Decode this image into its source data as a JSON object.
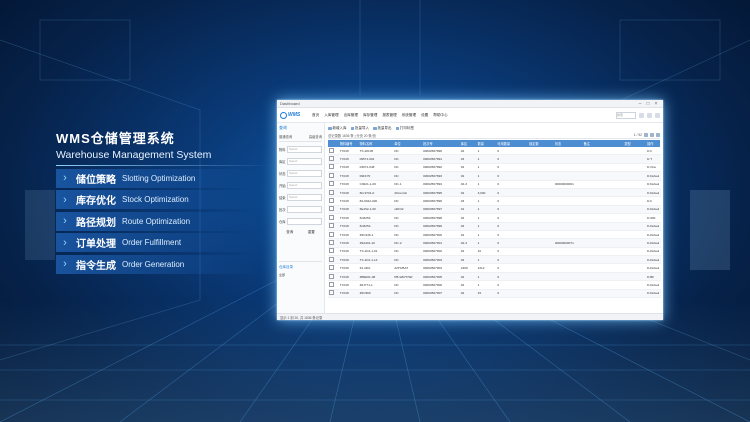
{
  "promo": {
    "title": "WMS仓储管理系统",
    "subtitle": "Warehouse Management System",
    "features": [
      {
        "cn": "储位策略",
        "en": "Slotting Optimization"
      },
      {
        "cn": "库存优化",
        "en": "Stock Optimization"
      },
      {
        "cn": "路径规划",
        "en": "Route Optimization"
      },
      {
        "cn": "订单处理",
        "en": "Order Fulfillment"
      },
      {
        "cn": "指令生成",
        "en": "Order Generation"
      }
    ]
  },
  "app": {
    "window_title": "Dashboard",
    "logo_text": "WMS",
    "menu": [
      "首页",
      "入库管理",
      "出库管理",
      "库存管理",
      "报表管理",
      "系统管理",
      "设置",
      "帮助中心"
    ],
    "header_search_placeholder": "搜索",
    "sidebar": {
      "title": "查询",
      "tabs": [
        "普通查询",
        "高级查询"
      ],
      "filters": [
        {
          "label": "物料",
          "placeholder": "Select"
        },
        {
          "label": "库区",
          "placeholder": "Select"
        },
        {
          "label": "状态",
          "placeholder": "Select"
        },
        {
          "label": "开始",
          "placeholder": "Select"
        },
        {
          "label": "结束",
          "placeholder": "Select"
        },
        {
          "label": "批次",
          "placeholder": ""
        },
        {
          "label": "仓库",
          "placeholder": ""
        }
      ],
      "buttons": [
        "查询",
        "重置"
      ],
      "tree_title": "仓库目录",
      "tree_items": [
        "全部"
      ]
    },
    "toolbar": [
      "新增入库",
      "批量导入",
      "批量导出",
      "打印标签"
    ],
    "sub_toolbar": {
      "left": "总记录数 1836 条 | 分页 20 条/页",
      "right": "1 / 92"
    },
    "table": {
      "headers": [
        "",
        "物料编号",
        "物料名称",
        "单位",
        "批次号",
        "库区",
        "数量",
        "可用数量",
        "锁定数",
        "状态",
        "备注",
        "类型",
        "操作"
      ],
      "rows": [
        [
          "TXCW",
          "TX-20105",
          "DC",
          "00002567890",
          "02",
          "1",
          "0",
          "",
          "",
          "",
          "",
          "D.b",
          ""
        ],
        [
          "TXCW",
          "09571-001",
          "DC",
          "00002567891",
          "03",
          "1",
          "0",
          "",
          "",
          "",
          "",
          "D.T",
          ""
        ],
        [
          "TXCW",
          "03071-048",
          "DC",
          "00002567892",
          "02",
          "1",
          "0",
          "",
          "",
          "",
          "",
          "D.One",
          ""
        ],
        [
          "TXCW",
          "09FF70",
          "DC",
          "00002567893",
          "02",
          "1",
          "0",
          "",
          "",
          "",
          "",
          "D.Defaul",
          ""
        ],
        [
          "TXCW",
          "C3021-1-06",
          "DC-1",
          "00002567894",
          "02-3",
          "1",
          "0",
          "",
          "00000000001",
          "",
          "",
          "D.Defaul",
          ""
        ],
        [
          "TXCW",
          "6D-9701-0",
          "20mm/dc",
          "00002567895",
          "02",
          "3,000",
          "0",
          "",
          "",
          "",
          "",
          "D.Defaul",
          ""
        ],
        [
          "TXCW",
          "84-0322-020",
          "DC",
          "00002567896",
          "03",
          "1",
          "0",
          "",
          "",
          "",
          "",
          "D.b",
          ""
        ],
        [
          "TXCW",
          "6E152-1-00",
          "sDF32",
          "00002567897",
          "01",
          "1",
          "0",
          "",
          "",
          "",
          "",
          "D.Defaul",
          ""
        ],
        [
          "TXCW",
          "6C8254",
          "DC",
          "00002567898",
          "02",
          "1",
          "0",
          "",
          "",
          "",
          "",
          "D.000",
          ""
        ],
        [
          "TXCW",
          "6C8254",
          "DC",
          "00002567899",
          "02",
          "1",
          "0",
          "",
          "",
          "",
          "",
          "D.Defaul",
          ""
        ],
        [
          "TXCW",
          "Z9C236-1",
          "DC",
          "00002567900",
          "02",
          "1",
          "0",
          "",
          "",
          "",
          "",
          "D.Defaul",
          ""
        ],
        [
          "TXCW",
          "Z9A401-10",
          "DC-2",
          "00002567901",
          "02-3",
          "1",
          "0",
          "",
          "00000000071",
          "",
          "",
          "D.Defaul",
          ""
        ],
        [
          "TXCW",
          "TX-2C2-1-01",
          "DC",
          "00002567902",
          "02",
          "10",
          "0",
          "",
          "",
          "",
          "",
          "D.Defaul",
          ""
        ],
        [
          "TXCW",
          "TX-2C2-1-14",
          "DC",
          "00002567903",
          "02",
          "1",
          "0",
          "",
          "",
          "",
          "",
          "D.Defaul",
          ""
        ],
        [
          "TXCW",
          "Z1.2DG",
          "22TF/BAT",
          "00002567904",
          "2400",
          "1212",
          "0",
          "",
          "",
          "",
          "",
          "D.Defaul",
          ""
        ],
        [
          "TXCW",
          "ZB6E01-08",
          "PB-WR/T/SR",
          "00002567905",
          "02",
          "1",
          "0",
          "",
          "",
          "",
          "",
          "D.BF",
          ""
        ],
        [
          "TXCW",
          "Z6J771-1",
          "DC",
          "00002567906",
          "02",
          "1",
          "0",
          "",
          "",
          "",
          "",
          "D.Defaul",
          ""
        ],
        [
          "TXCW",
          "Z6C960",
          "DC",
          "00002567907",
          "02",
          "15",
          "0",
          "",
          "",
          "",
          "",
          "D.Defaul",
          ""
        ]
      ]
    },
    "footer": "显示 1 到 20, 共 1836 条记录"
  }
}
